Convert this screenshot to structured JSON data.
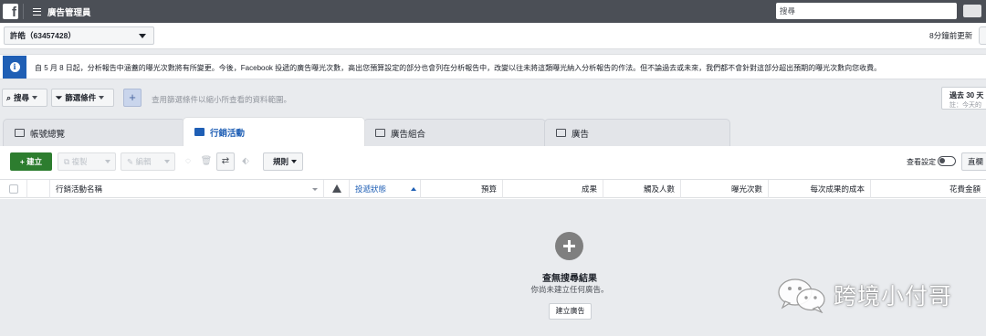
{
  "topbar": {
    "logo": "f",
    "title": "廣告管理員",
    "search_placeholder": "搜尋"
  },
  "account": {
    "selector_label": "許皓（63457428）",
    "updated": "8分鐘前更新"
  },
  "notice": {
    "icon": "i",
    "text": "自 5 月 8 日起，分析報告中涵蓋的曝光次數將有所變更。今後，Facebook 投遞的廣告曝光次數，高出您預算設定的部分也會列在分析報告中，改變以往未將這類曝光納入分析報告的作法。但不論過去或未來，我們都不會針對這部分超出預期的曝光次數向您收費。"
  },
  "filters": {
    "search_label": "搜尋",
    "filter_label": "篩選條件",
    "add_label": "+",
    "hint": "查用篩選條件以縮小所查看的資料範圍。",
    "date_line1": "過去 30 天",
    "date_line2": "註：今天的"
  },
  "tabs": [
    {
      "label": "帳號總覽"
    },
    {
      "label": "行銷活動"
    },
    {
      "label": "廣告組合"
    },
    {
      "label": "廣告"
    }
  ],
  "toolbar": {
    "create_label": "+ 建立",
    "duplicate_label": "複製",
    "edit_label": "編輯",
    "rules_label": "規則",
    "view_settings": "查看設定",
    "direct_label": "直欄"
  },
  "table": {
    "columns": [
      "行銷活動名稱",
      "投遞狀態",
      "預算",
      "成果",
      "觸及人數",
      "曝光次數",
      "每次成果的成本",
      "花費金額"
    ]
  },
  "empty_state": {
    "title": "查無搜尋結果",
    "subtitle": "你尚未建立任何廣告。",
    "button": "建立廣告"
  },
  "watermark": {
    "text": "跨境小付哥"
  }
}
